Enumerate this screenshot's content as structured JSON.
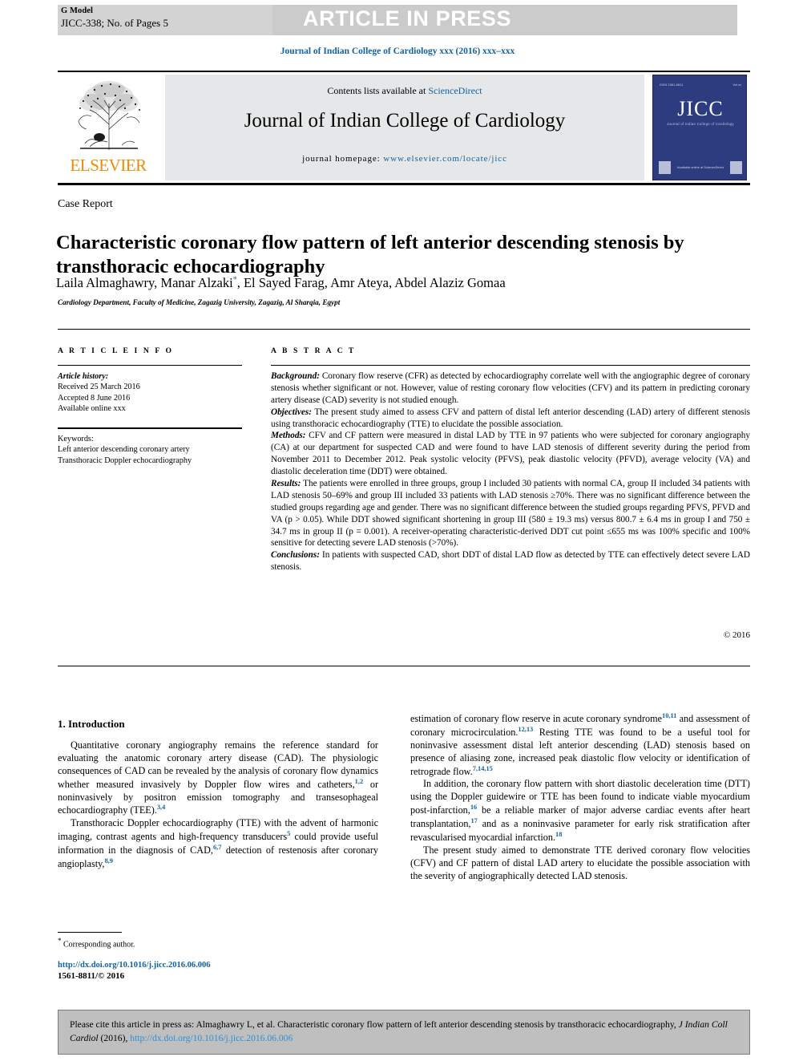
{
  "topbar": {
    "gmodel_line1": "G Model",
    "gmodel_line2": "JICC-338; No. of Pages 5",
    "article_in_press": "ARTICLE IN PRESS"
  },
  "running_head": "Journal of Indian College of Cardiology xxx (2016) xxx–xxx",
  "masthead": {
    "publisher_name": "ELSEVIER",
    "contents_prefix": "Contents lists available at ",
    "contents_link": "ScienceDirect",
    "journal_title": "Journal of Indian College of Cardiology",
    "homepage_label": "journal homepage: ",
    "homepage_url": "www.elsevier.com/locate/jicc",
    "cover": {
      "top_left": "ISSN 1561-8811",
      "top_right": "Vol xx",
      "acronym": "JICC",
      "subtitle": "Journal of Indian College of Cardiology",
      "bottom_mid": "Available online at\nScienceDirect"
    }
  },
  "article": {
    "doctype": "Case Report",
    "title": "Characteristic coronary flow pattern of left anterior descending stenosis by transthoracic echocardiography",
    "authors": "Laila Almaghawry, Manar Alzaki",
    "authors_rest": ", El Sayed Farag, Amr Ateya, Abdel Alaziz Gomaa",
    "corresponding_marker": "*",
    "affiliation": "Cardiology Department, Faculty of Medicine, Zagazig University, Zagazig, Al Sharqia, Egypt"
  },
  "article_info": {
    "heading": "A R T I C L E   I N F O",
    "history_label": "Article history:",
    "received": "Received 25 March 2016",
    "accepted": "Accepted 8 June 2016",
    "available": "Available online xxx",
    "keywords_label": "Keywords:",
    "keywords": [
      "Left anterior descending coronary artery",
      "Transthoracic Doppler echocardiography"
    ]
  },
  "abstract": {
    "heading": "A B S T R A C T",
    "background_label": "Background:",
    "background": " Coronary flow reserve (CFR) as detected by echocardiography correlate well with the angiographic degree of coronary stenosis whether significant or not. However, value of resting coronary flow velocities (CFV) and its pattern in predicting coronary artery disease (CAD) severity is not studied enough.",
    "objectives_label": "Objectives:",
    "objectives": " The present study aimed to assess CFV and pattern of distal left anterior descending (LAD) artery of different stenosis using transthoracic echocardiography (TTE) to elucidate the possible association.",
    "methods_label": "Methods:",
    "methods": " CFV and CF pattern were measured in distal LAD by TTE in 97 patients who were subjected for coronary angiography (CA) at our department for suspected CAD and were found to have LAD stenosis of different severity during the period from November 2011 to December 2012. Peak systolic velocity (PFVS), peak diastolic velocity (PFVD), average velocity (VA) and diastolic deceleration time (DDT) were obtained.",
    "results_label": "Results:",
    "results": " The patients were enrolled in three groups, group I included 30 patients with normal CA, group II included 34 patients with LAD stenosis 50–69% and group III included 33 patients with LAD stenosis ≥70%. There was no significant difference between the studied groups regarding age and gender. There was no significant difference between the studied groups regarding PFVS, PFVD and VA (p > 0.05). While DDT showed significant shortening in group III (580 ± 19.3 ms) versus 800.7 ± 6.4 ms in group I and 750 ± 34.7 ms in group II (p = 0.001). A receiver-operating characteristic-derived DDT cut point ≤655 ms was 100% specific and 100% sensitive for detecting severe LAD stenosis (>70%).",
    "conclusions_label": "Conclusions:",
    "conclusions": " In patients with suspected CAD, short DDT of distal LAD flow as detected by TTE can effectively detect severe LAD stenosis.",
    "copyright": "© 2016"
  },
  "body": {
    "section1_heading": "1. Introduction",
    "left_p1": "Quantitative coronary angiography remains the reference standard for evaluating the anatomic coronary artery disease (CAD). The physiologic consequences of CAD can be revealed by the analysis of coronary flow dynamics whether measured invasively by Doppler flow wires and catheters,",
    "left_p1_ref1": "1,2",
    "left_p1_b": " or noninvasively by positron emission tomography and transesophageal echocardiography (TEE).",
    "left_p1_ref2": "3,4",
    "left_p2_a": "Transthoracic Doppler echocardiography (TTE) with the advent of harmonic imaging, contrast agents and high-frequency transducers",
    "left_p2_ref1": "5",
    "left_p2_b": " could provide useful information in the diagnosis of CAD,",
    "left_p2_ref2": "6,7",
    "left_p2_c": " detection of restenosis after coronary angioplasty,",
    "left_p2_ref3": "8,9",
    "right_p1_a": "estimation of coronary flow reserve in acute coronary syndrome",
    "right_p1_ref1": "10,11",
    "right_p1_b": " and assessment of coronary microcirculation.",
    "right_p1_ref2": "12,13",
    "right_p1_c": " Resting TTE was found to be a useful tool for noninvasive assessment distal left anterior descending (LAD) stenosis based on presence of aliasing zone, increased peak diastolic flow velocity or identification of retrograde flow.",
    "right_p1_ref3": "7,14,15",
    "right_p2_a": "In addition, the coronary flow pattern with short diastolic deceleration time (DTT) using the Doppler guidewire or TTE has been found to indicate viable myocardium post-infarction,",
    "right_p2_ref1": "16",
    "right_p2_b": " be a reliable marker of major adverse cardiac events after heart transplantation,",
    "right_p2_ref2": "17",
    "right_p2_c": " and as a noninvasive parameter for early risk stratification after revascularised myocardial infarction.",
    "right_p2_ref3": "18",
    "right_p3": "The present study aimed to demonstrate TTE derived coronary flow velocities (CFV) and CF pattern of distal LAD artery to elucidate the possible association with the severity of angiographically detected LAD stenosis."
  },
  "footnote": {
    "marker": "*",
    "text": " Corresponding author.",
    "doi": "http://dx.doi.org/10.1016/j.jicc.2016.06.006",
    "issn": "1561-8811/© 2016"
  },
  "cite_box": {
    "prefix": "Please cite this article in press as: Almaghawry L, et al. Characteristic coronary flow pattern of left anterior descending stenosis by transthoracic echocardiography, ",
    "journal_abbrev": "J Indian Coll Cardiol",
    "year": " (2016), ",
    "link": "http://dx.doi.org/10.1016/j.jicc.2016.06.006"
  },
  "colors": {
    "link_blue": "#1262a0",
    "elsevier_orange": "#f08a00",
    "cover_blue": "#2d3c7e",
    "banner_gray": "#cbcbcb"
  }
}
